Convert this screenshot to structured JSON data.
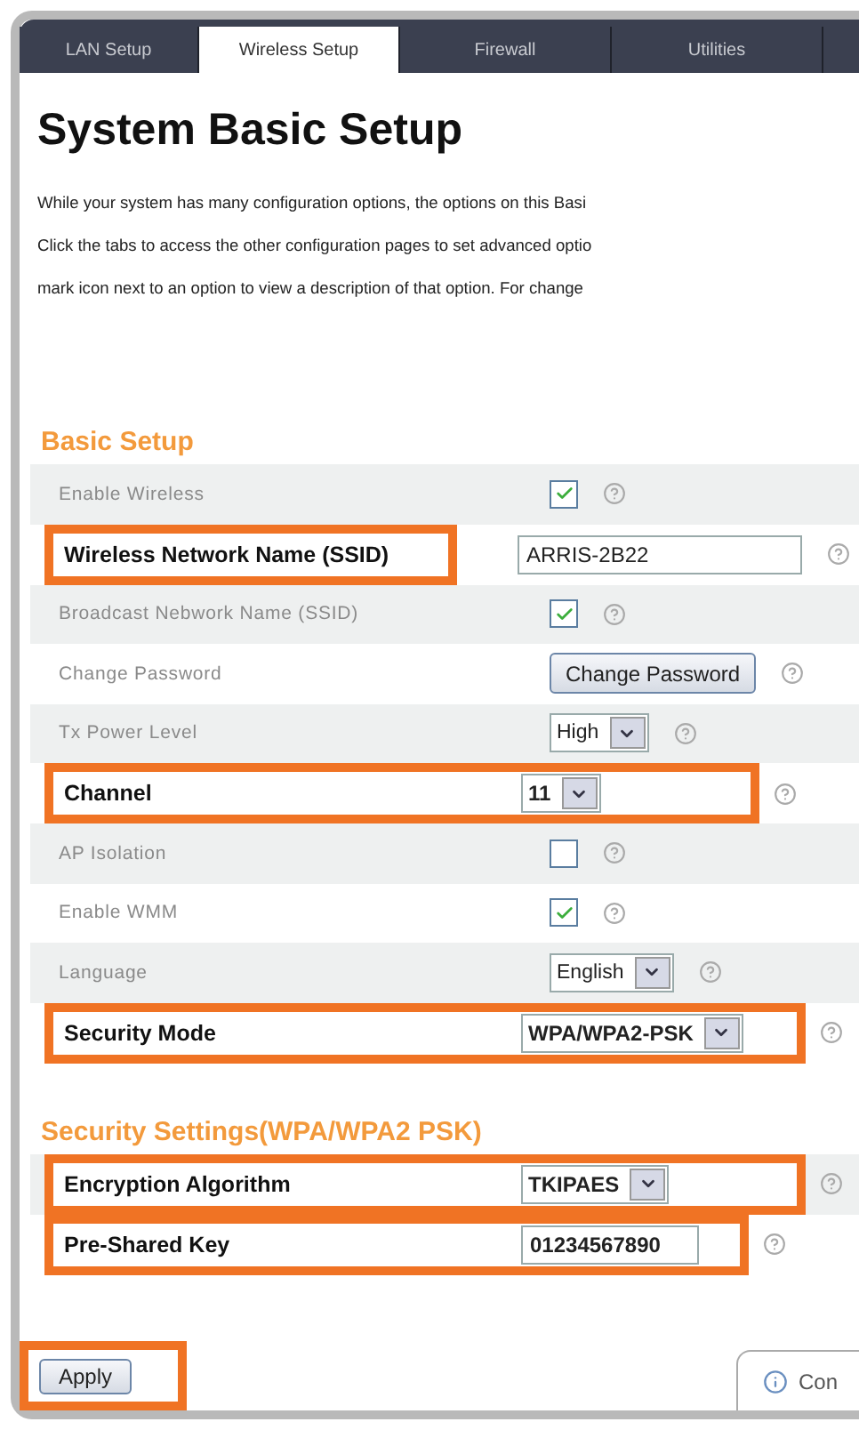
{
  "tabs": [
    {
      "label": "LAN Setup",
      "selected": false
    },
    {
      "label": "Wireless Setup",
      "selected": true
    },
    {
      "label": "Firewall",
      "selected": false
    },
    {
      "label": "Utilities",
      "selected": false
    }
  ],
  "title": "System Basic Setup",
  "intro_lines": [
    "While your system has many configuration options, the options on this Basi",
    "Click the tabs to access the other configuration pages to set advanced optio",
    "mark icon next to an option to view a description of that option. For change"
  ],
  "sections": [
    {
      "heading": "Basic Setup",
      "rows": [
        {
          "label": "Enable Wireless",
          "kind": "checkbox",
          "checked": true,
          "label_highlighted": false,
          "control_highlighted": false
        },
        {
          "label": "Wireless Network Name (SSID)",
          "kind": "text",
          "value": "ARRIS-2B22",
          "label_highlighted": true,
          "control_highlighted": false
        },
        {
          "label": "Broadcast Nebwork Name (SSID)",
          "kind": "checkbox",
          "checked": true,
          "label_highlighted": false,
          "control_highlighted": false
        },
        {
          "label": "Change Password",
          "kind": "button",
          "value": "Change Password",
          "label_highlighted": false,
          "control_highlighted": false
        },
        {
          "label": "Tx Power Level",
          "kind": "select",
          "value": "High",
          "label_highlighted": false,
          "control_highlighted": false
        },
        {
          "label": "Channel",
          "kind": "select",
          "value": "11",
          "label_highlighted": true,
          "control_highlighted": true
        },
        {
          "label": "AP Isolation",
          "kind": "checkbox",
          "checked": false,
          "label_highlighted": false,
          "control_highlighted": false
        },
        {
          "label": "Enable WMM",
          "kind": "checkbox",
          "checked": true,
          "label_highlighted": false,
          "control_highlighted": false
        },
        {
          "label": "Language",
          "kind": "select",
          "value": "English",
          "label_highlighted": false,
          "control_highlighted": false
        },
        {
          "label": "Security Mode",
          "kind": "select",
          "value": "WPA/WPA2-PSK",
          "label_highlighted": true,
          "control_highlighted": true
        }
      ]
    },
    {
      "heading": "Security Settings(WPA/WPA2 PSK)",
      "rows": [
        {
          "label": "Encryption Algorithm",
          "kind": "select",
          "value": "TKIPAES",
          "label_highlighted": true,
          "control_highlighted": true
        },
        {
          "label": "Pre-Shared Key",
          "kind": "text",
          "value": "01234567890",
          "label_highlighted": true,
          "control_highlighted": true
        }
      ]
    }
  ],
  "apply_button": {
    "label": "Apply",
    "highlighted": true
  },
  "connect_button": {
    "label": "Con"
  }
}
